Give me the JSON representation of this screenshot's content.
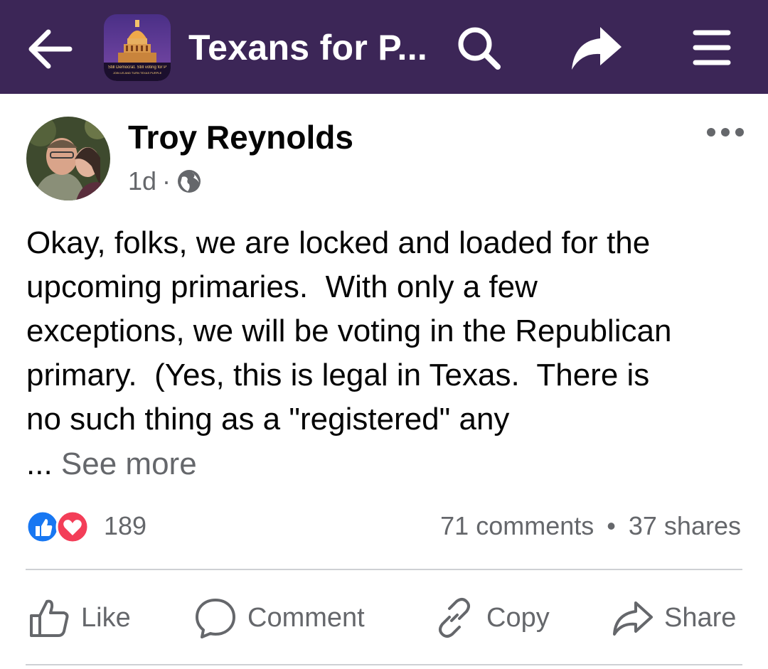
{
  "header": {
    "title": "Texans for P...",
    "thumb_caption_line1": "Still Democrat. Still voting for P",
    "thumb_caption_line2": "JOIN US AND TURN TEXAS PURPLE",
    "bg_color": "#3c2657"
  },
  "post": {
    "author": "Troy Reynolds",
    "time": "1d",
    "separator": "·",
    "text": "Okay, folks, we are locked and loaded for the\nupcoming primaries.  With only a few\nexceptions, we will be voting in the Republican\nprimary.  (Yes, this is legal in Texas.  There is\nno such thing as a \"registered\" any",
    "ellipsis": "...",
    "see_more": "See more"
  },
  "engagement": {
    "reactions_count": "189",
    "comments": "71 comments",
    "dot": "•",
    "shares": "37 shares"
  },
  "actions": {
    "like": "Like",
    "comment": "Comment",
    "copy": "Copy",
    "share": "Share"
  },
  "icons": [
    "back-arrow-icon",
    "search-icon",
    "share-arrow-icon",
    "menu-icon",
    "more-options-icon",
    "globe-icon",
    "like-reaction-icon",
    "love-reaction-icon",
    "thumbs-up-icon",
    "comment-bubble-icon",
    "link-icon",
    "share-icon"
  ]
}
